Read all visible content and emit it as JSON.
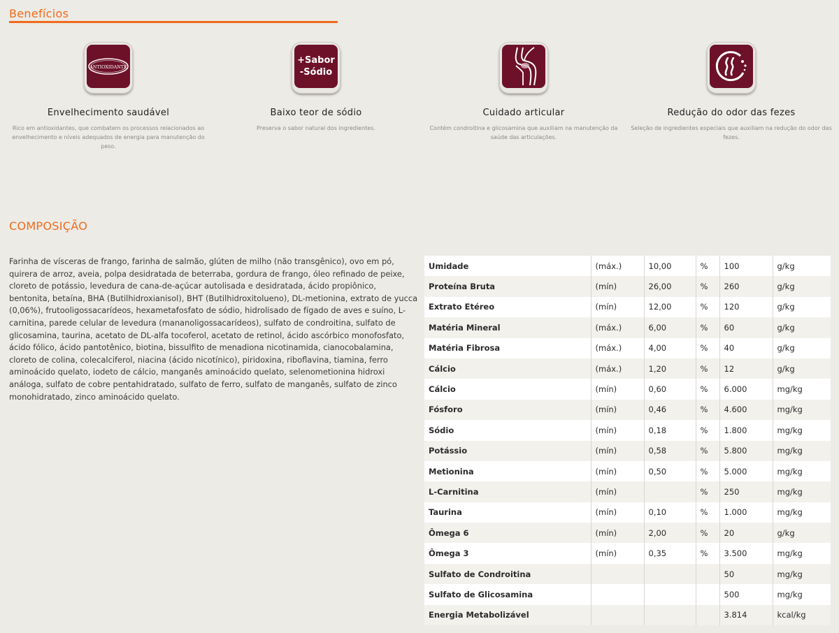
{
  "beneficios": {
    "title": "Benefícios",
    "items": [
      {
        "icon": "antioxidante-icon",
        "icon_text": "ANTIOXIDANTE",
        "title": "Envelhecimento saudável",
        "desc": "Rico em antioxidantes, que combatem os processos relacionados ao envelhecimento e níveis adequados de energia para manutenção do peso."
      },
      {
        "icon": "sabor-sodio-icon",
        "icon_text_1": "+Sabor",
        "icon_text_2": "-Sódio",
        "title": "Baixo teor de sódio",
        "desc": "Preserva o sabor natural dos ingredientes."
      },
      {
        "icon": "joint-icon",
        "title": "Cuidado articular",
        "desc": "Contém condroitina e glicosamina que auxiliam na manutenção da saúde das articulações."
      },
      {
        "icon": "odor-icon",
        "title": "Redução do odor das fezes",
        "desc": "Seleção de ingredientes especiais que auxiliam na redução do odor das fezes."
      }
    ]
  },
  "composicao": {
    "title": "COMPOSIÇÃO",
    "text": "Farinha de vísceras de frango, farinha de salmão, glúten de milho (não transgênico), ovo em pó, quirera de arroz, aveia, polpa desidratada de beterraba, gordura de frango, óleo refinado de peixe, cloreto de potássio, levedura de cana-de-açúcar autolisada e desidratada, ácido propiônico, bentonita, betaína, BHA (Butilhidroxianisol), BHT (Butilhidroxitolueno), DL-metionina, extrato de yucca (0,06%), frutooligossacarídeos, hexametafosfato de sódio, hidrolisado de fígado de aves e suíno, L-carnitina, parede celular de levedura (mananoligossacarídeos), sulfato de condroitina, sulfato de glicosamina, taurina, acetato de DL-alfa tocoferol, acetato de retinol, ácido ascórbico monofosfato, ácido fólico, ácido pantotênico, biotina, bissulfito de menadiona nicotinamida, cianocobalamina, cloreto de colina, colecalciferol, niacina (ácido nicotínico), piridoxina, riboflavina, tiamina, ferro aminoácido quelato, iodeto de cálcio, manganês aminoácido quelato, selenometionina hidroxi análoga, sulfato de cobre pentahidratado, sulfato de ferro, sulfato de manganês, sulfato de zinco monohidratado, zinco aminoácido quelato."
  },
  "tabela": {
    "rows": [
      [
        "Umidade",
        "(máx.)",
        "10,00",
        "%",
        "100",
        "g/kg"
      ],
      [
        "Proteína Bruta",
        "(mín)",
        "26,00",
        "%",
        "260",
        "g/kg"
      ],
      [
        "Extrato Etéreo",
        "(mín)",
        "12,00",
        "%",
        "120",
        "g/kg"
      ],
      [
        "Matéria Mineral",
        "(máx.)",
        "6,00",
        "%",
        "60",
        "g/kg"
      ],
      [
        "Matéria Fibrosa",
        "(máx.)",
        "4,00",
        "%",
        "40",
        "g/kg"
      ],
      [
        "Cálcio",
        "(máx.)",
        "1,20",
        "%",
        "12",
        "g/kg"
      ],
      [
        "Cálcio",
        "(mín)",
        "0,60",
        "%",
        "6.000",
        "mg/kg"
      ],
      [
        "Fósforo",
        "(mín)",
        "0,46",
        "%",
        "4.600",
        "mg/kg"
      ],
      [
        "Sódio",
        "(mín)",
        "0,18",
        "%",
        "1.800",
        "mg/kg"
      ],
      [
        "Potássio",
        "(mín)",
        "0,58",
        "%",
        "5.800",
        "mg/kg"
      ],
      [
        "Metionina",
        "(mín)",
        "0,50",
        "%",
        "5.000",
        "mg/kg"
      ],
      [
        "L-Carnitina",
        "(mín)",
        "",
        "%",
        "250",
        "mg/kg"
      ],
      [
        "Taurina",
        "(mín)",
        "0,10",
        "%",
        "1.000",
        "mg/kg"
      ],
      [
        "Ômega 6",
        "(mín)",
        "2,00",
        "%",
        "20",
        "g/kg"
      ],
      [
        "Ômega 3",
        "(mín)",
        "0,35",
        "%",
        "3.500",
        "mg/kg"
      ],
      [
        "Sulfato de Condroitina",
        "",
        "",
        "",
        "50",
        "mg/kg"
      ],
      [
        "Sulfato de Glicosamina",
        "",
        "",
        "",
        "500",
        "mg/kg"
      ],
      [
        "Energia Metabolizável",
        "",
        "",
        "",
        "3.814",
        "kcal/kg"
      ]
    ]
  },
  "colors": {
    "accent": "#f06a1c",
    "icon_bg": "#6d1129",
    "page_bg": "#edebe5"
  }
}
